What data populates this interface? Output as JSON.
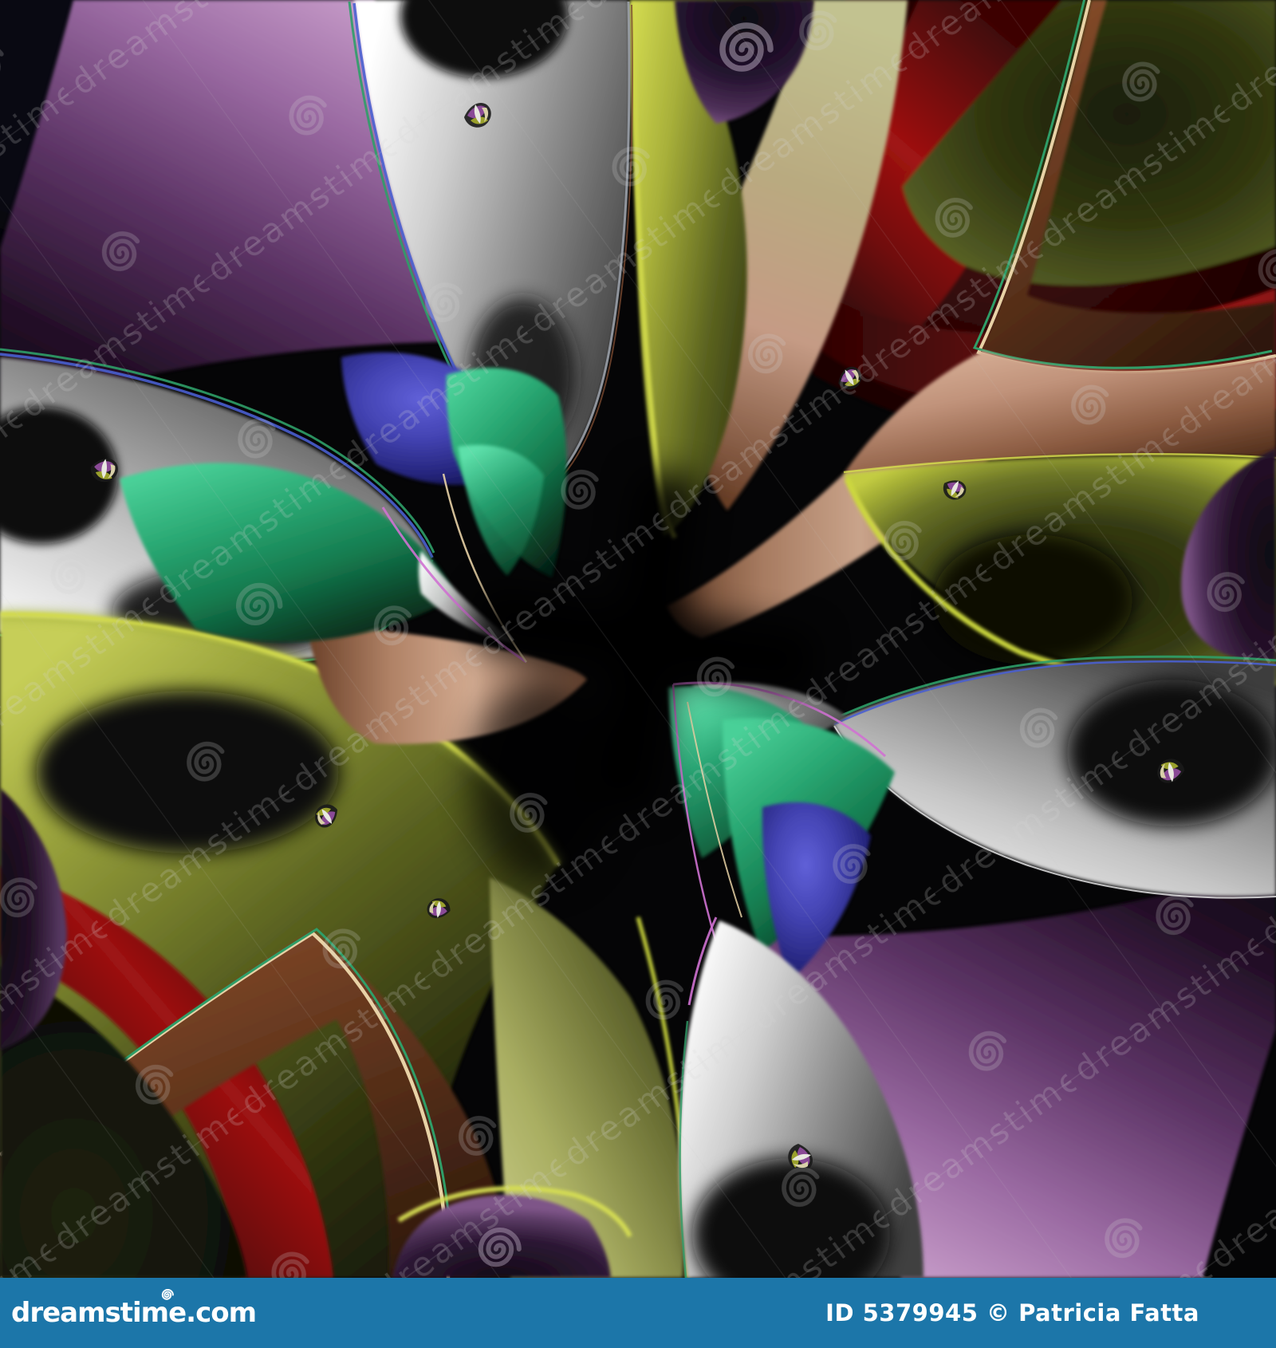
{
  "artwork": {
    "watermark": {
      "text": "dreamstime",
      "tile_symbol": "spiral",
      "line_color": "#cccccc",
      "text_color": "#d8d8d8"
    },
    "palette": {
      "background": "#050506",
      "purple_highlight": "#c79cc9",
      "purple_dark": "#2a1530",
      "silver": "#e9e9e9",
      "olive": "#aab23c",
      "chartreuse": "#d2da4c",
      "red": "#a01212",
      "maroon": "#2a0606",
      "tan": "#c49a82",
      "brown": "#6b3a20",
      "teal": "#2aa873",
      "indigo": "#4343b2",
      "pink_outline": "#cf72d2",
      "cream_outline": "#e8d2a6"
    },
    "decorative_glyph_count": 8
  },
  "footer": {
    "brand": "dreamstime.com",
    "credit": "ID 5379945 © Patricia Fatta",
    "bar_color": "#1c76a9",
    "text_color": "#ffffff"
  }
}
